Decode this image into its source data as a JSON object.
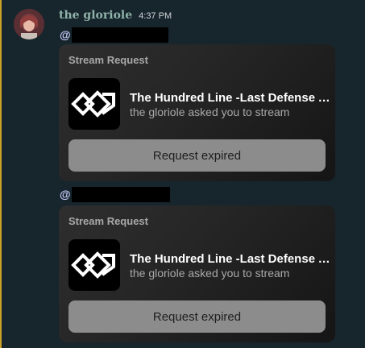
{
  "message": {
    "author": "the gloriole",
    "timestamp": "4:37 PM",
    "accent_color": "#8fb3a8"
  },
  "mentions": [
    {
      "at": "@"
    },
    {
      "at": "@"
    }
  ],
  "cards": [
    {
      "header": "Stream Request",
      "game_title": "The Hundred Line -Last Defense Academy-",
      "subtitle": "the gloriole asked you to stream",
      "button_label": "Request expired",
      "icon": "hundred-line-game-icon"
    },
    {
      "header": "Stream Request",
      "game_title": "The Hundred Line -Last Defense Academy-",
      "subtitle": "the gloriole asked you to stream",
      "button_label": "Request expired",
      "icon": "hundred-line-game-icon"
    }
  ]
}
